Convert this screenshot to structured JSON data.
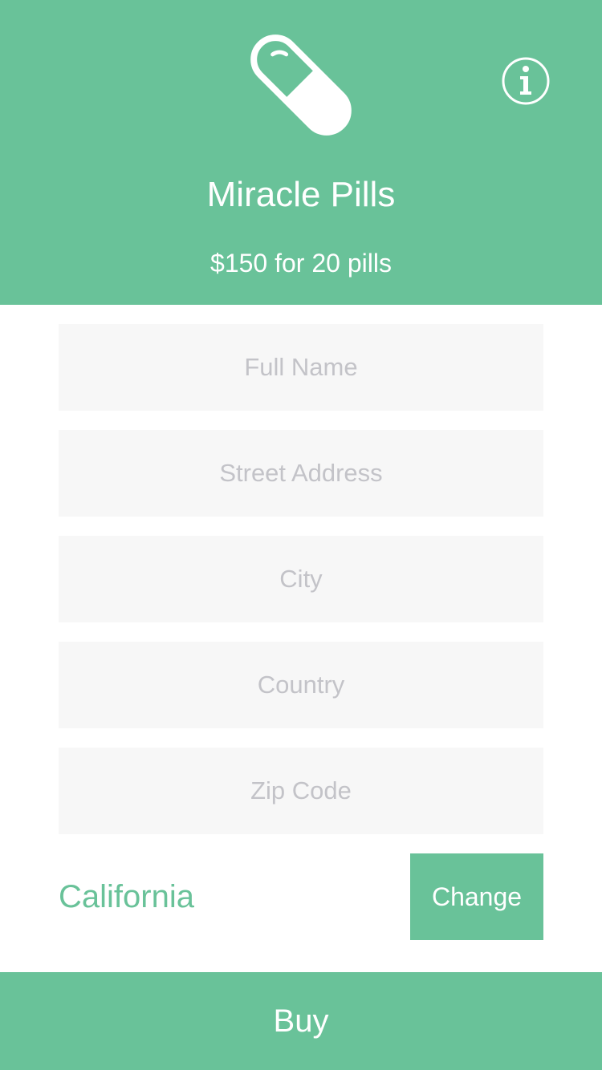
{
  "colors": {
    "accent": "#69c299",
    "field_background": "#f7f7f7",
    "placeholder": "#c3c3c8",
    "text_on_accent": "#ffffff"
  },
  "header": {
    "icon": "pill-icon",
    "info_icon": "info-icon",
    "title": "Miracle Pills",
    "subtitle": "$150 for 20 pills"
  },
  "form": {
    "full_name": {
      "value": "",
      "placeholder": "Full Name"
    },
    "street_address": {
      "value": "",
      "placeholder": "Street Address"
    },
    "city": {
      "value": "",
      "placeholder": "City"
    },
    "country": {
      "value": "",
      "placeholder": "Country"
    },
    "zip_code": {
      "value": "",
      "placeholder": "Zip Code"
    }
  },
  "state": {
    "value": "California",
    "change_label": "Change"
  },
  "buy_label": "Buy"
}
